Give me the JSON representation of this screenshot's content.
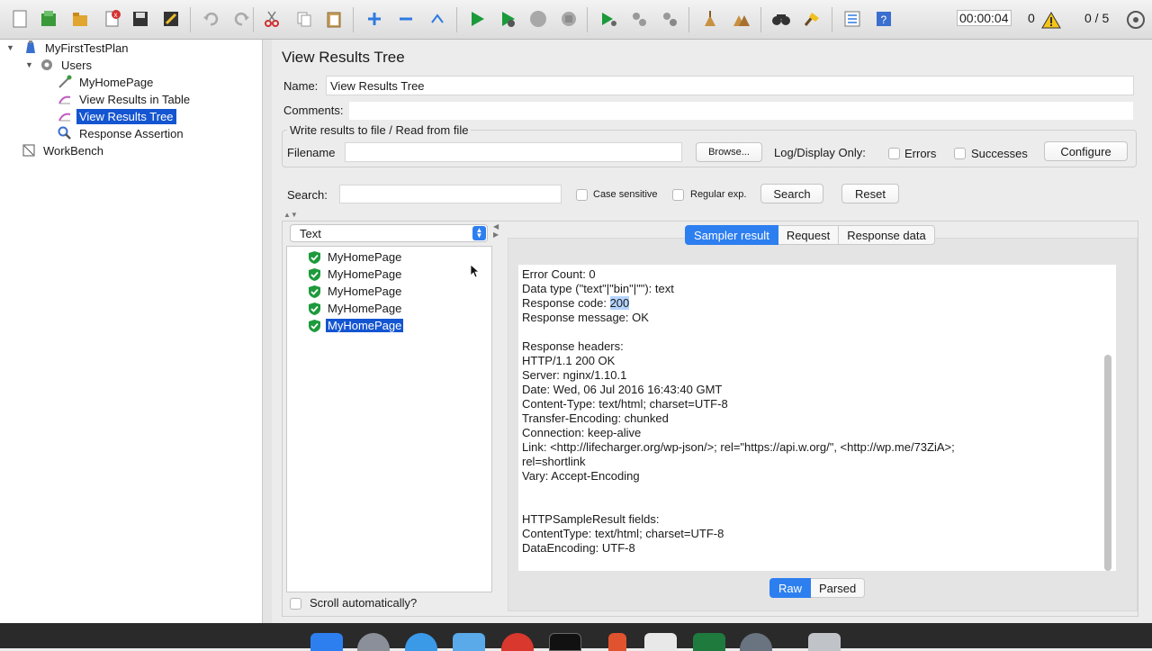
{
  "toolbar": {
    "timer": "00:00:04",
    "warnings": "0",
    "threads": "0 / 5",
    "icons": [
      "new-icon",
      "templates-icon",
      "open-icon",
      "close-icon",
      "save-icon",
      "save-as-icon",
      "undo-icon",
      "redo-icon",
      "cut-icon",
      "copy-icon",
      "paste-icon",
      "expand-icon",
      "collapse-icon",
      "toggle-icon",
      "start-icon",
      "start-no-pause-icon",
      "stop-icon",
      "shutdown-icon",
      "remote-start-icon",
      "remote-stop-icon",
      "remote-shutdown-icon",
      "clear-icon",
      "clear-all-icon",
      "search-icon",
      "reset-search-icon",
      "function-helper-icon",
      "help-icon"
    ]
  },
  "tree": {
    "items": [
      {
        "label": "MyFirstTestPlan"
      },
      {
        "label": "Users"
      },
      {
        "label": "MyHomePage"
      },
      {
        "label": "View Results in Table"
      },
      {
        "label": "View Results Tree"
      },
      {
        "label": "Response Assertion"
      },
      {
        "label": "WorkBench"
      }
    ]
  },
  "panel": {
    "title": "View Results Tree",
    "name_label": "Name:",
    "name_value": "View Results Tree",
    "comments_label": "Comments:",
    "file_group_title": "Write results to file / Read from file",
    "filename_label": "Filename",
    "filename_value": "",
    "browse_label": "Browse...",
    "log_display_label": "Log/Display Only:",
    "errors_label": "Errors",
    "successes_label": "Successes",
    "configure_label": "Configure"
  },
  "search": {
    "label": "Search:",
    "value": "",
    "case_sensitive_label": "Case sensitive",
    "regex_label": "Regular exp.",
    "search_button": "Search",
    "reset_button": "Reset"
  },
  "renderer": {
    "selected": "Text"
  },
  "samples": [
    "MyHomePage",
    "MyHomePage",
    "MyHomePage",
    "MyHomePage",
    "MyHomePage"
  ],
  "tabs": {
    "sampler_result": "Sampler result",
    "request": "Request",
    "response_data": "Response data"
  },
  "detail": {
    "lines": [
      "Error Count: 0",
      "Data type (\"text\"|\"bin\"|\"\"): text",
      "Response code: ",
      "Response message: OK",
      "",
      "Response headers:",
      "HTTP/1.1 200 OK",
      "Server: nginx/1.10.1",
      "Date: Wed, 06 Jul 2016 16:43:40 GMT",
      "Content-Type: text/html; charset=UTF-8",
      "Transfer-Encoding: chunked",
      "Connection: keep-alive",
      "Link: <http://lifecharger.org/wp-json/>; rel=\"https://api.w.org/\", <http://wp.me/73ZiA>;",
      "rel=shortlink",
      "Vary: Accept-Encoding",
      "",
      "",
      "HTTPSampleResult fields:",
      "ContentType: text/html; charset=UTF-8",
      "DataEncoding: UTF-8"
    ],
    "response_code_value": "200"
  },
  "view_tabs": {
    "raw": "Raw",
    "parsed": "Parsed"
  },
  "scroll_auto_label": "Scroll automatically?"
}
